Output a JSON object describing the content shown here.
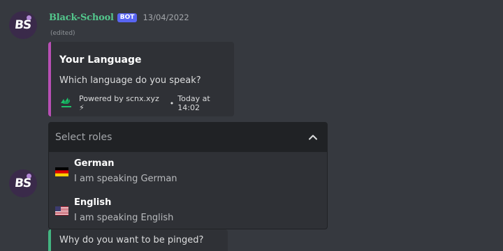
{
  "message1": {
    "author": "Black-School",
    "badge": "BOT",
    "timestamp": "13/04/2022",
    "edited": "(edited)",
    "avatar_text": "BS"
  },
  "embed": {
    "accent_color": "#b84fb5",
    "title": "Your Language",
    "description": "Which language do you speak?",
    "footer_text": "Powered by scnx.xyz ⚡",
    "footer_separator": "•",
    "footer_time": "Today at 14:02"
  },
  "select_menu": {
    "placeholder": "Select roles",
    "expanded": true,
    "options": [
      {
        "label": "German",
        "description": "I am speaking German",
        "flag": "german-flag-icon"
      },
      {
        "label": "English",
        "description": "I am speaking English",
        "flag": "us-flag-icon"
      }
    ]
  },
  "message2": {
    "avatar_text": "BS",
    "embed_accent_color": "#43b581",
    "embed_description": "Why do you want to be pinged?"
  }
}
